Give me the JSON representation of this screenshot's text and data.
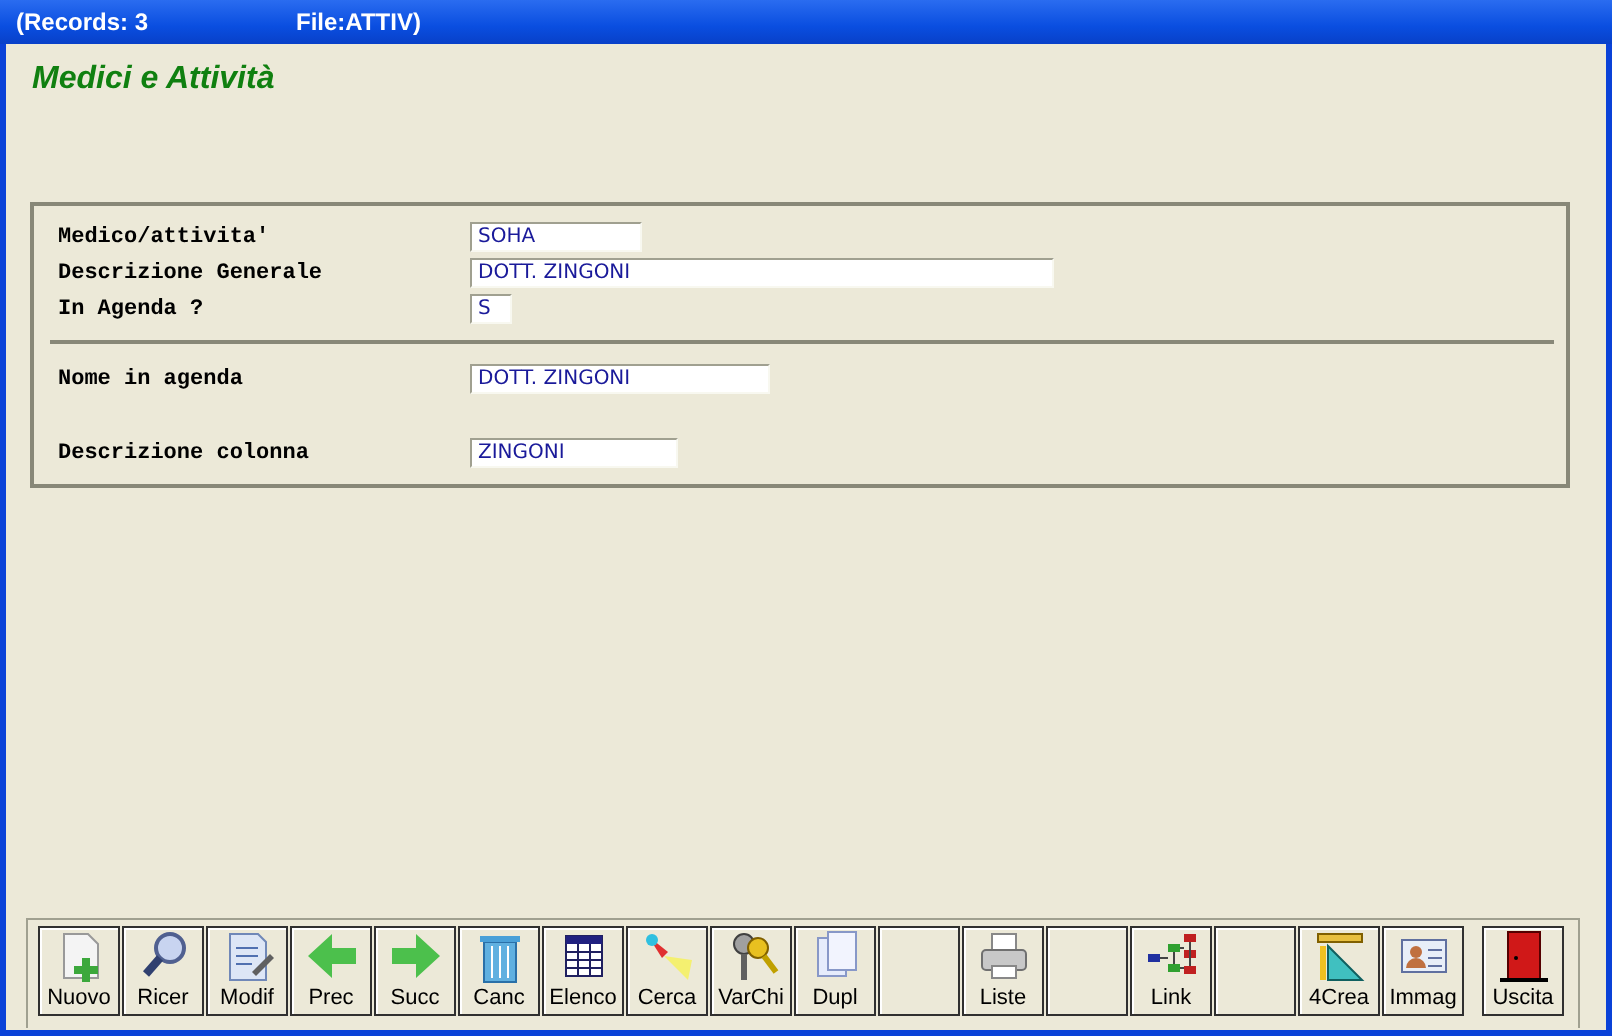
{
  "window": {
    "title_records": "(Records: 3",
    "title_file": "File:ATTIV)"
  },
  "heading": "Medici e Attività",
  "sections": [
    {
      "fields": [
        {
          "label": "Medico/attivita'",
          "value": "SOHA"
        },
        {
          "label": "Descrizione Generale",
          "value": "DOTT. ZINGONI"
        },
        {
          "label": "In Agenda ?",
          "value": "S"
        }
      ]
    },
    {
      "fields": [
        {
          "label": "Nome in agenda",
          "value": "DOTT. ZINGONI"
        },
        {
          "label": "Descrizione colonna",
          "value": "ZINGONI"
        }
      ]
    }
  ],
  "toolbar": [
    {
      "kind": "button",
      "label": "Nuovo"
    },
    {
      "kind": "button",
      "label": "Ricer"
    },
    {
      "kind": "button",
      "label": "Modif"
    },
    {
      "kind": "button",
      "label": "Prec"
    },
    {
      "kind": "button",
      "label": "Succ"
    },
    {
      "kind": "button",
      "label": "Canc"
    },
    {
      "kind": "button",
      "label": "Elenco"
    },
    {
      "kind": "button",
      "label": "Cerca"
    },
    {
      "kind": "button",
      "label": "VarChi"
    },
    {
      "kind": "button",
      "label": "Dupl"
    },
    {
      "kind": "blank"
    },
    {
      "kind": "button",
      "label": "Liste"
    },
    {
      "kind": "blank"
    },
    {
      "kind": "button",
      "label": "Link"
    },
    {
      "kind": "blank"
    },
    {
      "kind": "button",
      "label": "4Crea"
    },
    {
      "kind": "button",
      "label": "Immag"
    },
    {
      "kind": "exit",
      "label": "Uscita"
    }
  ]
}
